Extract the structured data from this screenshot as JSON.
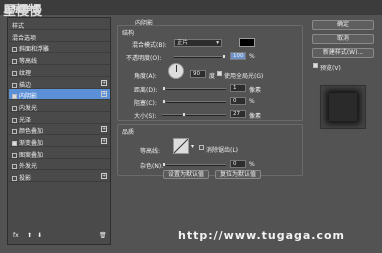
{
  "window": {
    "title": "图层样式",
    "watermark_top": "星慢慢"
  },
  "sidebar": {
    "items": [
      {
        "label": "样式",
        "checkbox": false,
        "checked": false,
        "plus": false,
        "selected": false
      },
      {
        "label": "混合选项",
        "checkbox": false,
        "checked": false,
        "plus": false,
        "selected": false
      },
      {
        "label": "斜面和浮雕",
        "checkbox": true,
        "checked": false,
        "plus": false,
        "selected": false
      },
      {
        "label": "等高线",
        "checkbox": true,
        "checked": false,
        "plus": false,
        "selected": false
      },
      {
        "label": "纹理",
        "checkbox": true,
        "checked": false,
        "plus": false,
        "selected": false
      },
      {
        "label": "描边",
        "checkbox": true,
        "checked": false,
        "plus": true,
        "selected": false
      },
      {
        "label": "内阴影",
        "checkbox": true,
        "checked": true,
        "plus": true,
        "selected": true
      },
      {
        "label": "内发光",
        "checkbox": true,
        "checked": false,
        "plus": false,
        "selected": false
      },
      {
        "label": "光泽",
        "checkbox": true,
        "checked": false,
        "plus": false,
        "selected": false
      },
      {
        "label": "颜色叠加",
        "checkbox": true,
        "checked": false,
        "plus": true,
        "selected": false
      },
      {
        "label": "渐变叠加",
        "checkbox": true,
        "checked": true,
        "plus": true,
        "selected": false
      },
      {
        "label": "图案叠加",
        "checkbox": true,
        "checked": false,
        "plus": false,
        "selected": false
      },
      {
        "label": "外发光",
        "checkbox": true,
        "checked": false,
        "plus": false,
        "selected": false
      },
      {
        "label": "投影",
        "checkbox": true,
        "checked": false,
        "plus": true,
        "selected": false
      }
    ],
    "footer": {
      "fx": "fx",
      "up": "⬆",
      "down": "⬇",
      "trash": "🗑"
    }
  },
  "panel": {
    "title": "内阴影",
    "structure": {
      "label": "结构",
      "blend_mode_label": "混合模式(B):",
      "blend_mode_value": "正片",
      "opacity_label": "不透明度(O):",
      "opacity_value": "100",
      "percent": "%",
      "angle_label": "角度(A):",
      "angle_value": "90",
      "degree": "度",
      "global_light_label": "使用全局光(G)",
      "distance_label": "距离(D):",
      "distance_value": "1",
      "px": "像素",
      "choke_label": "阻塞(C):",
      "choke_value": "0",
      "choke_unit": "%",
      "size_label": "大小(S):",
      "size_value": "27",
      "size_unit": "像素"
    },
    "quality": {
      "label": "品质",
      "contour_label": "等高线:",
      "antialias_label": "消除锯齿(L)",
      "noise_label": "杂色(N):",
      "noise_value": "0",
      "noise_unit": "%"
    },
    "buttons": {
      "default": "设置为默认值",
      "reset": "复位为默认值"
    }
  },
  "right": {
    "ok": "确定",
    "cancel": "取消",
    "new_style": "新建样式(W)...",
    "preview_label": "预览(V)"
  },
  "watermark_bottom": "http://www.tugaga.com"
}
